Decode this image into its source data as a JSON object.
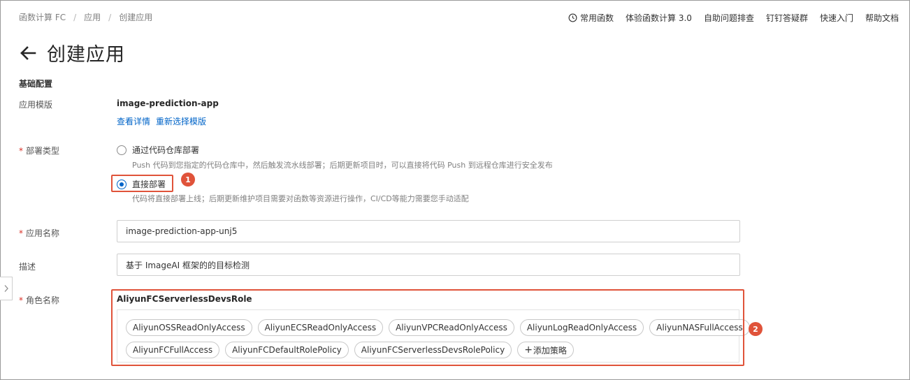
{
  "breadcrumb": [
    "函数计算 FC",
    "应用",
    "创建应用"
  ],
  "breadcrumb_sep": "/",
  "topnav": [
    "常用函数",
    "体验函数计算 3.0",
    "自助问题排查",
    "钉钉答疑群",
    "快速入门",
    "帮助文档"
  ],
  "page": {
    "title": "创建应用"
  },
  "section": {
    "basic_config": "基础配置"
  },
  "template": {
    "label": "应用模版",
    "name": "image-prediction-app",
    "view_details": "查看详情",
    "reselect": "重新选择模版"
  },
  "deploy": {
    "required_mark": "*",
    "label": "部署类型",
    "options": [
      {
        "label": "通过代码仓库部署",
        "desc": "Push 代码到您指定的代码仓库中，然后触发流水线部署；后期更新项目时，可以直接将代码 Push 到远程仓库进行安全发布",
        "selected": false
      },
      {
        "label": "直接部署",
        "desc": "代码将直接部署上线；后期更新维护项目需要对函数等资源进行操作，CI/CD等能力需要您手动适配",
        "selected": true
      }
    ]
  },
  "app_name": {
    "required_mark": "*",
    "label": "应用名称",
    "value": "image-prediction-app-unj5"
  },
  "description": {
    "label": "描述",
    "value": "基于 ImageAI 框架的的目标检测"
  },
  "role": {
    "required_mark": "*",
    "label": "角色名称",
    "name": "AliyunFCServerlessDevsRole",
    "policies_row1": [
      "AliyunOSSReadOnlyAccess",
      "AliyunECSReadOnlyAccess",
      "AliyunVPCReadOnlyAccess",
      "AliyunLogReadOnlyAccess",
      "AliyunNASFullAccess"
    ],
    "policies_row2": [
      "AliyunFCFullAccess",
      "AliyunFCDefaultRolePolicy",
      "AliyunFCServerlessDevsRolePolicy"
    ],
    "add_policy": "添加策略"
  },
  "annotations": {
    "marker1": "1",
    "marker2": "2"
  },
  "colors": {
    "link": "#0064c8",
    "highlight": "#e0533a",
    "required": "#d93026"
  }
}
